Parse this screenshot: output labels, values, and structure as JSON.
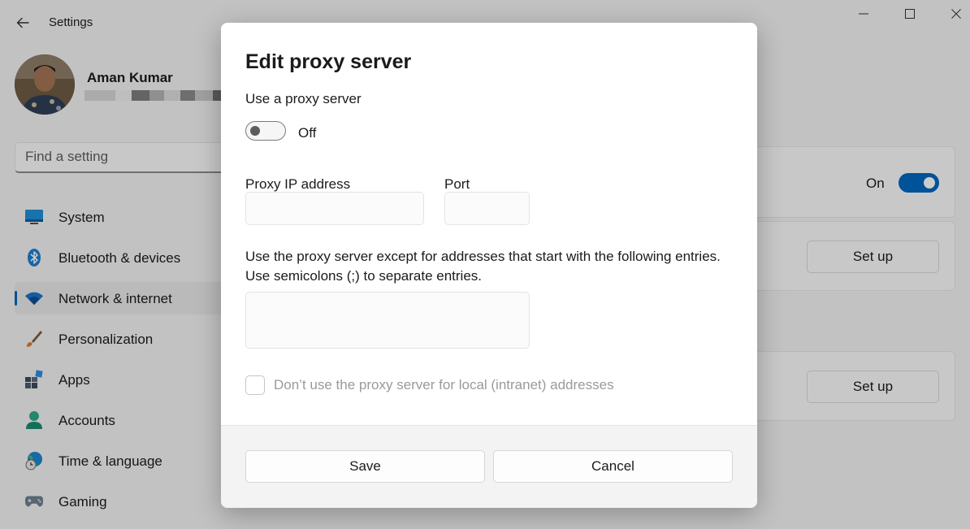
{
  "window": {
    "title": "Settings",
    "controls": [
      "minimize-icon",
      "maximize-icon",
      "close-icon"
    ]
  },
  "profile": {
    "name": "Aman Kumar"
  },
  "search": {
    "placeholder": "Find a setting"
  },
  "nav": {
    "items": [
      {
        "label": "System",
        "icon": "system-icon"
      },
      {
        "label": "Bluetooth & devices",
        "icon": "bluetooth-icon"
      },
      {
        "label": "Network & internet",
        "icon": "wifi-icon",
        "selected": true
      },
      {
        "label": "Personalization",
        "icon": "paintbrush-icon"
      },
      {
        "label": "Apps",
        "icon": "apps-icon"
      },
      {
        "label": "Accounts",
        "icon": "person-icon"
      },
      {
        "label": "Time & language",
        "icon": "globe-clock-icon"
      },
      {
        "label": "Gaming",
        "icon": "gamepad-icon"
      }
    ]
  },
  "background": {
    "toggle_label": "On",
    "setup_label_1": "Set up",
    "setup_label_2": "Set up"
  },
  "dialog": {
    "title": "Edit proxy server",
    "use_proxy_label": "Use a proxy server",
    "toggle_state": "Off",
    "ip_label": "Proxy IP address",
    "ip_value": "",
    "port_label": "Port",
    "port_value": "",
    "exceptions_text_1": "Use the proxy server except for addresses that start with the following entries.",
    "exceptions_text_2": "Use semicolons (;) to separate entries.",
    "exceptions_value": "",
    "local_checkbox_label": "Don’t use the proxy server for local (intranet) addresses",
    "local_checkbox_checked": false,
    "save_label": "Save",
    "cancel_label": "Cancel"
  },
  "colors": {
    "accent": "#0067c0",
    "window_bg": "#f3f3f3",
    "dialog_bg": "#ffffff"
  }
}
